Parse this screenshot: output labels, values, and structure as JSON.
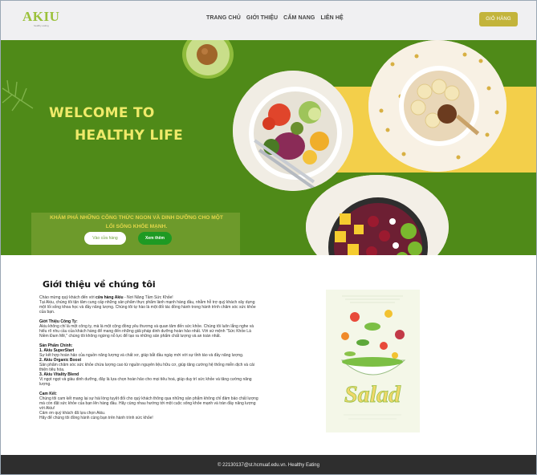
{
  "brand": {
    "logo": "AKIU",
    "logo_sub": "healthy eating"
  },
  "nav": {
    "items": [
      "TRANG CHỦ",
      "GIỚI THIỆU",
      "CẨM NANG",
      "LIÊN HỆ"
    ]
  },
  "header": {
    "cart_label": "GIỎ HÀNG"
  },
  "hero": {
    "title_line1": "WELCOME TO",
    "title_line2": "HEALTHY LIFE",
    "subtitle": "KHÁM PHÁ NHỮNG CÔNG THỨC NGON VÀ DINH DƯỠNG CHO MỘT LỐI SỐNG KHỎE MẠNH.",
    "btn_menu": "Vào cửa hàng",
    "btn_view": "Xem thêm"
  },
  "about": {
    "title": "Giới thiệu về chúng tôi",
    "intro_prefix": "Chào mừng quý khách đến với ",
    "intro_brand": "cửa hàng Akiu",
    "intro_suffix": " - Nơi Nâng Tầm Sức Khỏe!",
    "intro_body": "Tại Akiu, chúng tôi tận tâm cung cấp những sản phẩm thực phẩm lành mạnh hàng đầu, nhằm hỗ trợ quý khách xây dựng một lối sống khoa học và đầy năng lượng. Chúng tôi tự hào là một đối tác đồng hành trong hành trình chăm sóc sức khỏe của bạn.",
    "company_title": "Giới Thiệu Công Ty:",
    "company_body": "Akiu không chỉ là một công ty, mà là một cộng đồng yêu thương và quan tâm đến sức khỏe. Chúng tôi luôn lắng nghe và hiểu rõ nhu cầu của khách hàng để mang đến những giải pháp dinh dưỡng hoàn hảo nhất. Với sứ mệnh \"Sức Khỏe Là Niềm Đam Mê,\" chúng tôi không ngừng nỗ lực để tạo ra những sản phẩm chất lượng và an toàn nhất.",
    "products_title": "Sản Phẩm Chính:",
    "p1_title": "1. Akiu SuperStart",
    "p1_body": "Sự kết hợp hoàn hảo của nguồn năng lượng và chất xơ, giúp bắt đầu ngày mới với sự tỉnh táo và đầy năng lượng.",
    "p2_title": "2. Akiu Organic Boost",
    "p2_body": "Sản phẩm chăm sóc sức khỏe chứa lượng cao từ nguồn nguyên liệu hữu cơ, giúp tăng cường hệ thống miễn dịch và cải thiện tiêu hóa.",
    "p3_title": "3. Akiu Vitality Blend",
    "p3_body": "Vị ngọt ngọt và giàu dinh dưỡng, đây là lựa chọn hoàn hảo cho mọi tiêu hoá, giúp duy trì sức khỏe và tăng cường năng lượng.",
    "thanks_title": "Cam Kết:",
    "thanks_body": "Chúng tôi cam kết mang lại sự hài lòng tuyệt đối cho quý khách thông qua những sản phẩm không chỉ đảm bảo chất lượng mà còn đặt sức khỏe của bạn lên hàng đầu. Hãy cùng nhau hướng tới một cuộc sống khỏe mạnh và tràn đầy năng lượng với Akiu!",
    "closing1": "Cảm ơn quý khách đã lựa chọn Akiu.",
    "closing2": "Hãy để chúng tôi đồng hành cùng bạn trên hành trình sức khỏe!"
  },
  "poster": {
    "word": "Salad"
  },
  "footer": {
    "text": "© 22130137@st.hcmuaf.edu.vn. Healthy Eating"
  },
  "colors": {
    "hero_green": "#4f8a18",
    "band_yellow": "#f3cf4a",
    "title_yellow": "#f0ea6a",
    "cart_gold": "#c3b43b",
    "button_green": "#1e9a23",
    "footer_dark": "#2e2e2e"
  }
}
